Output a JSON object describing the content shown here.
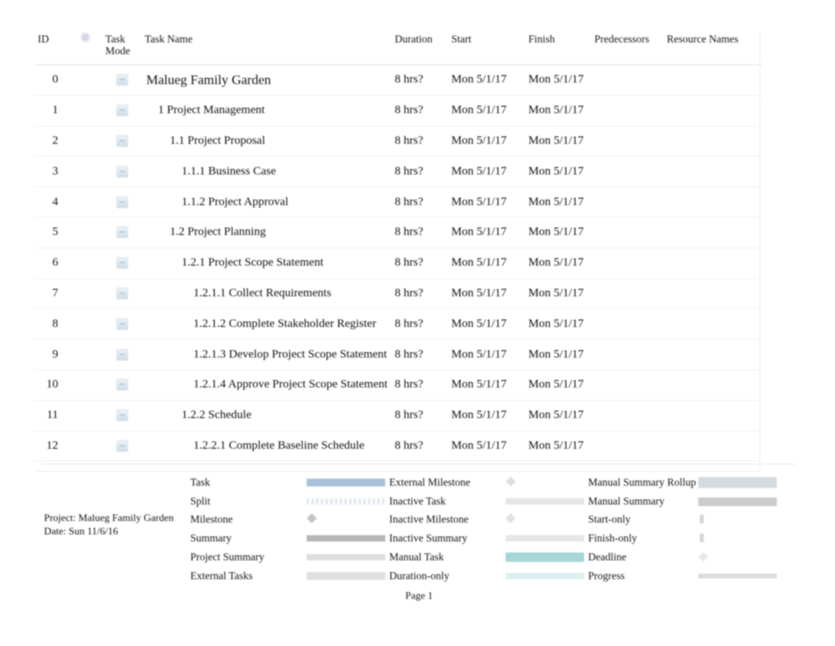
{
  "document": {
    "type": "gantt-chart-print-preview",
    "page_footer": "Page 1",
    "project_line": "Project: Malueg Family Garden",
    "date_line": "Date: Sun 11/6/16"
  },
  "table": {
    "headers": {
      "id": "ID",
      "indicator": "",
      "task_mode_line1": "Task",
      "task_mode_line2": "Mode",
      "task_name": "Task Name",
      "duration": "Duration",
      "start": "Start",
      "finish": "Finish",
      "predecessors": "Predecessors",
      "resource_names": "Resource Names"
    },
    "rows": [
      {
        "id": "0",
        "indent": 0,
        "name": "Malueg Family Garden",
        "duration": "8 hrs?",
        "start": "Mon 5/1/17",
        "finish": "Mon 5/1/17",
        "predecessors": "",
        "resources": ""
      },
      {
        "id": "1",
        "indent": 1,
        "name": "1 Project Management",
        "duration": "8 hrs?",
        "start": "Mon 5/1/17",
        "finish": "Mon 5/1/17",
        "predecessors": "",
        "resources": ""
      },
      {
        "id": "2",
        "indent": 2,
        "name": "1.1 Project Proposal",
        "duration": "8 hrs?",
        "start": "Mon 5/1/17",
        "finish": "Mon 5/1/17",
        "predecessors": "",
        "resources": ""
      },
      {
        "id": "3",
        "indent": 3,
        "name": "1.1.1 Business Case",
        "duration": "8 hrs?",
        "start": "Mon 5/1/17",
        "finish": "Mon 5/1/17",
        "predecessors": "",
        "resources": ""
      },
      {
        "id": "4",
        "indent": 3,
        "name": "1.1.2 Project Approval",
        "duration": "8 hrs?",
        "start": "Mon 5/1/17",
        "finish": "Mon 5/1/17",
        "predecessors": "",
        "resources": ""
      },
      {
        "id": "5",
        "indent": 2,
        "name": "1.2 Project Planning",
        "duration": "8 hrs?",
        "start": "Mon 5/1/17",
        "finish": "Mon 5/1/17",
        "predecessors": "",
        "resources": ""
      },
      {
        "id": "6",
        "indent": 3,
        "name": "1.2.1 Project Scope Statement",
        "duration": "8 hrs?",
        "start": "Mon 5/1/17",
        "finish": "Mon 5/1/17",
        "predecessors": "",
        "resources": ""
      },
      {
        "id": "7",
        "indent": 4,
        "name": "1.2.1.1 Collect Requirements",
        "duration": "8 hrs?",
        "start": "Mon 5/1/17",
        "finish": "Mon 5/1/17",
        "predecessors": "",
        "resources": ""
      },
      {
        "id": "8",
        "indent": 4,
        "name": "1.2.1.2 Complete Stakeholder Register",
        "duration": "8 hrs?",
        "start": "Mon 5/1/17",
        "finish": "Mon 5/1/17",
        "predecessors": "",
        "resources": ""
      },
      {
        "id": "9",
        "indent": 4,
        "name": "1.2.1.3 Develop Project Scope Statement",
        "duration": "8 hrs?",
        "start": "Mon 5/1/17",
        "finish": "Mon 5/1/17",
        "predecessors": "",
        "resources": ""
      },
      {
        "id": "10",
        "indent": 4,
        "name": "1.2.1.4 Approve Project Scope Statement",
        "duration": "8 hrs?",
        "start": "Mon 5/1/17",
        "finish": "Mon 5/1/17",
        "predecessors": "",
        "resources": ""
      },
      {
        "id": "11",
        "indent": 3,
        "name": "1.2.2 Schedule",
        "duration": "8 hrs?",
        "start": "Mon 5/1/17",
        "finish": "Mon 5/1/17",
        "predecessors": "",
        "resources": ""
      },
      {
        "id": "12",
        "indent": 4,
        "name": "1.2.2.1 Complete Baseline Schedule",
        "duration": "8 hrs?",
        "start": "Mon 5/1/17",
        "finish": "Mon 5/1/17",
        "predecessors": "",
        "resources": ""
      }
    ]
  },
  "legend": {
    "columns": [
      {
        "items": [
          {
            "label": "Task",
            "swatch": "sw-task"
          },
          {
            "label": "Split",
            "swatch": "sw-split"
          },
          {
            "label": "Milestone",
            "swatch": "sw-milestone"
          },
          {
            "label": "Summary",
            "swatch": "sw-summary"
          },
          {
            "label": "Project Summary",
            "swatch": "sw-projsummary"
          },
          {
            "label": "External Tasks",
            "swatch": "sw-external"
          }
        ]
      },
      {
        "items": [
          {
            "label": "External Milestone",
            "swatch": "sw-extmilestone"
          },
          {
            "label": "Inactive Task",
            "swatch": "sw-inactivetask"
          },
          {
            "label": "Inactive Milestone",
            "swatch": "sw-inactivemilestone"
          },
          {
            "label": "Inactive Summary",
            "swatch": "sw-inactivesummary"
          },
          {
            "label": "Manual Task",
            "swatch": "sw-manualtask"
          },
          {
            "label": "Duration-only",
            "swatch": "sw-durationonly"
          }
        ]
      },
      {
        "items": [
          {
            "label": "Manual Summary Rollup",
            "swatch": "sw-msrollup"
          },
          {
            "label": "Manual Summary",
            "swatch": "sw-msummary"
          },
          {
            "label": "Start-only",
            "swatch": "sw-startonly"
          },
          {
            "label": "Finish-only",
            "swatch": "sw-finishonly"
          },
          {
            "label": "Deadline",
            "swatch": "sw-deadline"
          },
          {
            "label": "Progress",
            "swatch": "sw-progress"
          }
        ]
      }
    ]
  },
  "colors": {
    "task_bar": "#a9c2db",
    "manual_task_bar": "#a6d6d6",
    "summary_bar": "#9d9d9d",
    "manual_summary_rollup": "#ccd6dd",
    "indicator_dot": "#b9b3d8",
    "page_background": "#ffffff"
  }
}
